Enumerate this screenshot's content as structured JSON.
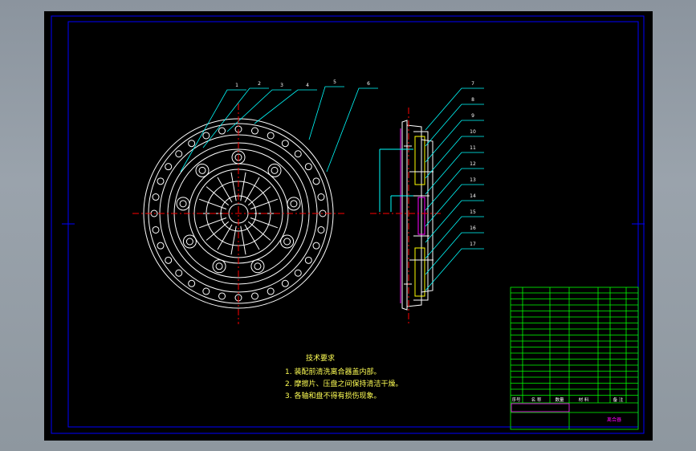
{
  "balloons": [
    "1",
    "2",
    "3",
    "4",
    "5",
    "6",
    "7",
    "8",
    "9",
    "10",
    "11",
    "12",
    "13",
    "14",
    "15",
    "16",
    "17"
  ],
  "technical_requirements": {
    "title": "技术要求",
    "items": [
      "1. 装配前清洗离合器盖内部。",
      "2. 摩擦片、压盘之间保持清洁干燥。",
      "3. 各轴和盘不得有损伤现象。"
    ]
  },
  "title_block": {
    "part_label": "离合器",
    "header_cols": [
      "序号",
      "名 称",
      "数量",
      "材 料",
      "备 注"
    ]
  },
  "colors": {
    "background": "#000000",
    "frame": "#0000ff",
    "part_lines": "#ffffff",
    "center_lines": "#ff0000",
    "leaders": "#00ffff",
    "table": "#00ff00",
    "table_highlight": "#ff00ff",
    "notes": "#ffff55"
  }
}
